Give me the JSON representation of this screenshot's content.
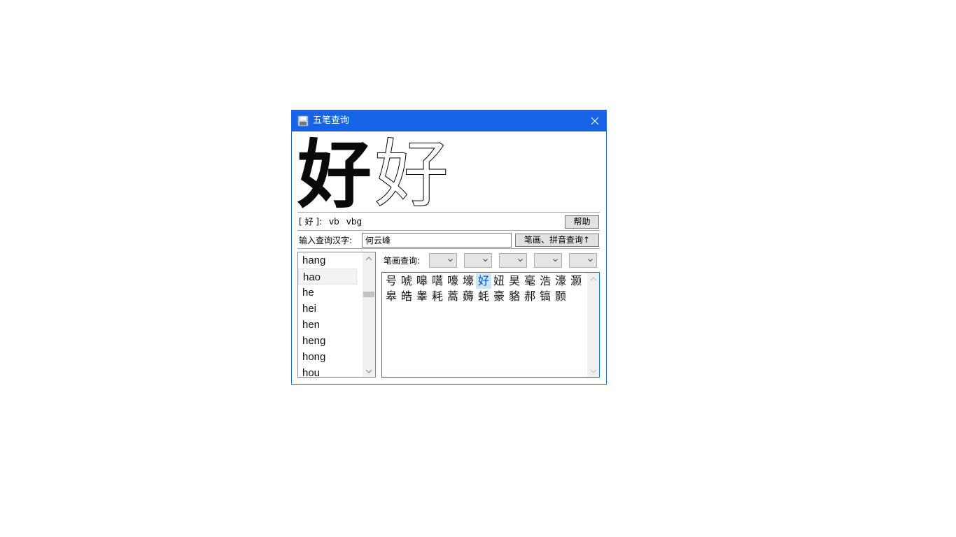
{
  "window": {
    "title": "五笔查询",
    "accent": "#1563e6"
  },
  "display_char": "好",
  "code_line": {
    "char_label": "[ 好 ]:",
    "code1": "vb",
    "code2": "vbg"
  },
  "buttons": {
    "help": "帮助",
    "query": "笔画、拼音查询↑"
  },
  "search": {
    "label": "输入查询汉字:",
    "value": "何云峰"
  },
  "pinyin_list": {
    "items": [
      "hang",
      "hao",
      "he",
      "hei",
      "hen",
      "heng",
      "hong",
      "hou"
    ],
    "selected": "hao"
  },
  "stroke_query": {
    "label": "笔画查询:",
    "selects": [
      "",
      "",
      "",
      "",
      ""
    ]
  },
  "characters": {
    "items": [
      "号",
      "唬",
      "嗥",
      "嚆",
      "嚎",
      "壕",
      "好",
      "妞",
      "昊",
      "毫",
      "浩",
      "濠",
      "灏",
      "皋",
      "皓",
      "睾",
      "耗",
      "蒿",
      "薅",
      "蚝",
      "豪",
      "貉",
      "郝",
      "镐",
      "颢"
    ],
    "selected": "好"
  }
}
